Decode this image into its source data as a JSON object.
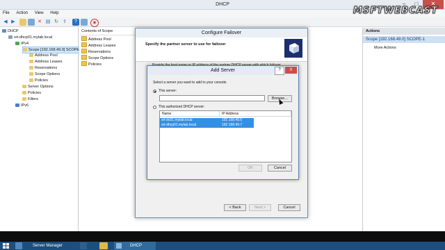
{
  "window": {
    "title": "DHCP"
  },
  "menu": [
    "File",
    "Action",
    "View",
    "Help"
  ],
  "tree": [
    {
      "label": "DHCP"
    },
    {
      "label": "srt-dhcp01.mylab.local"
    },
    {
      "label": "IPv4"
    },
    {
      "label": "Scope [192.168.49.0] SCOPE"
    },
    {
      "label": "Address Pool"
    },
    {
      "label": "Address Leases"
    },
    {
      "label": "Reservations"
    },
    {
      "label": "Scope Options"
    },
    {
      "label": "Policies"
    },
    {
      "label": "Server Options"
    },
    {
      "label": "Policies"
    },
    {
      "label": "Filters"
    },
    {
      "label": "IPv6"
    }
  ],
  "contents": {
    "header": "Contents of Scope",
    "items": [
      "Address Pool",
      "Address Leases",
      "Reservations",
      "Scope Options",
      "Policies"
    ]
  },
  "actions": {
    "header": "Actions",
    "section": "Scope [192.168.49.0] SCOPE-1",
    "more": "More Actions"
  },
  "wizard": {
    "title": "Configure Failover",
    "heading": "Specify the partner server to use for failover",
    "instruction": "Provide the host name or IP address of the partner DHCP server with which failover",
    "back": "< Back",
    "next": "Next >",
    "cancel": "Cancel"
  },
  "dialog": {
    "title": "Add Server",
    "help": "?",
    "close": "X",
    "prompt": "Select a server you want to add to your console.",
    "this_server_label": "This server:",
    "this_server_value": "",
    "browse": "Browse...",
    "authorized_label": "This authorized DHCP server:",
    "columns": [
      "Name",
      "IP Address"
    ],
    "rows": [
      {
        "name": "srt-dc01.mylab.local",
        "ip": "192.168.49.5"
      },
      {
        "name": "srt-dhcp01.mylab.local",
        "ip": "192.168.49.7"
      }
    ],
    "ok": "OK",
    "cancel": "Cancel"
  },
  "watermark": "MSFTWEBCAST",
  "taskbar": {
    "server_manager": "Server Manager",
    "dhcp": "DHCP"
  }
}
